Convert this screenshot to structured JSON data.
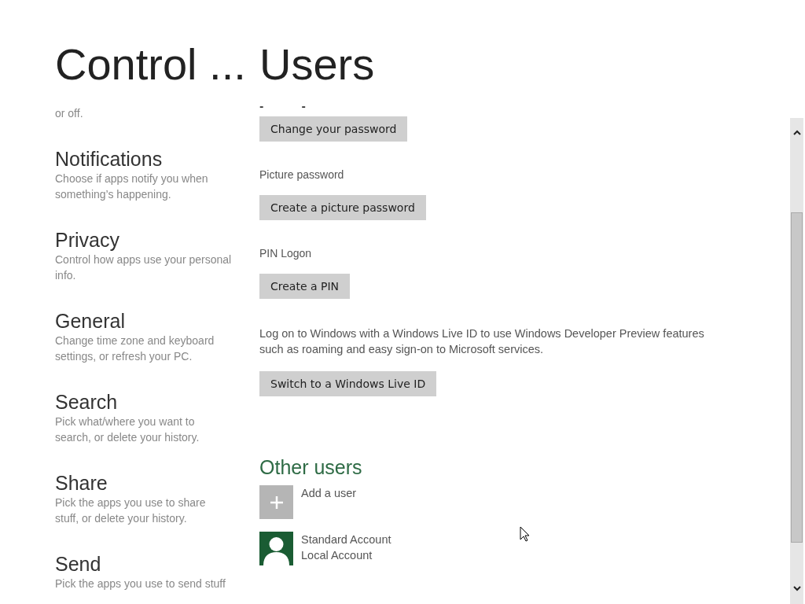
{
  "left": {
    "title": "Control ...",
    "items": [
      {
        "kind": "fragment",
        "description": "or off."
      },
      {
        "kind": "setting",
        "heading": "Notifications",
        "description": "Choose if apps notify you when something’s happening."
      },
      {
        "kind": "setting",
        "heading": "Privacy",
        "description": "Control how apps use your personal info."
      },
      {
        "kind": "setting",
        "heading": "General",
        "description": "Change time zone and keyboard settings, or refresh your PC."
      },
      {
        "kind": "setting",
        "heading": "Search",
        "description": "Pick what/where you want to search, or delete your history."
      },
      {
        "kind": "setting",
        "heading": "Share",
        "description": "Pick the apps you use to share stuff, or delete your history."
      },
      {
        "kind": "setting",
        "heading": "Send",
        "description": "Pick the apps you use to send stuff"
      }
    ]
  },
  "main": {
    "title": "Users",
    "marks": [
      "-",
      "-"
    ],
    "blocks": [
      {
        "kind": "button",
        "label": "Change your password"
      },
      {
        "kind": "label",
        "text": "Picture password"
      },
      {
        "kind": "button",
        "label": "Create a picture password"
      },
      {
        "kind": "label",
        "text": "PIN Logon"
      },
      {
        "kind": "button",
        "label": "Create a PIN"
      },
      {
        "kind": "paragraph",
        "text": "Log on to Windows with a Windows Live ID to use Windows Developer Preview features such as roaming and easy sign-on to Microsoft services."
      },
      {
        "kind": "button",
        "label": "Switch to a Windows Live ID"
      }
    ],
    "other_users": {
      "heading": "Other users",
      "users": [
        {
          "kind": "add",
          "lines": [
            "Add a user"
          ]
        },
        {
          "kind": "account",
          "lines": [
            "Standard Account",
            "Local Account"
          ]
        }
      ]
    }
  }
}
